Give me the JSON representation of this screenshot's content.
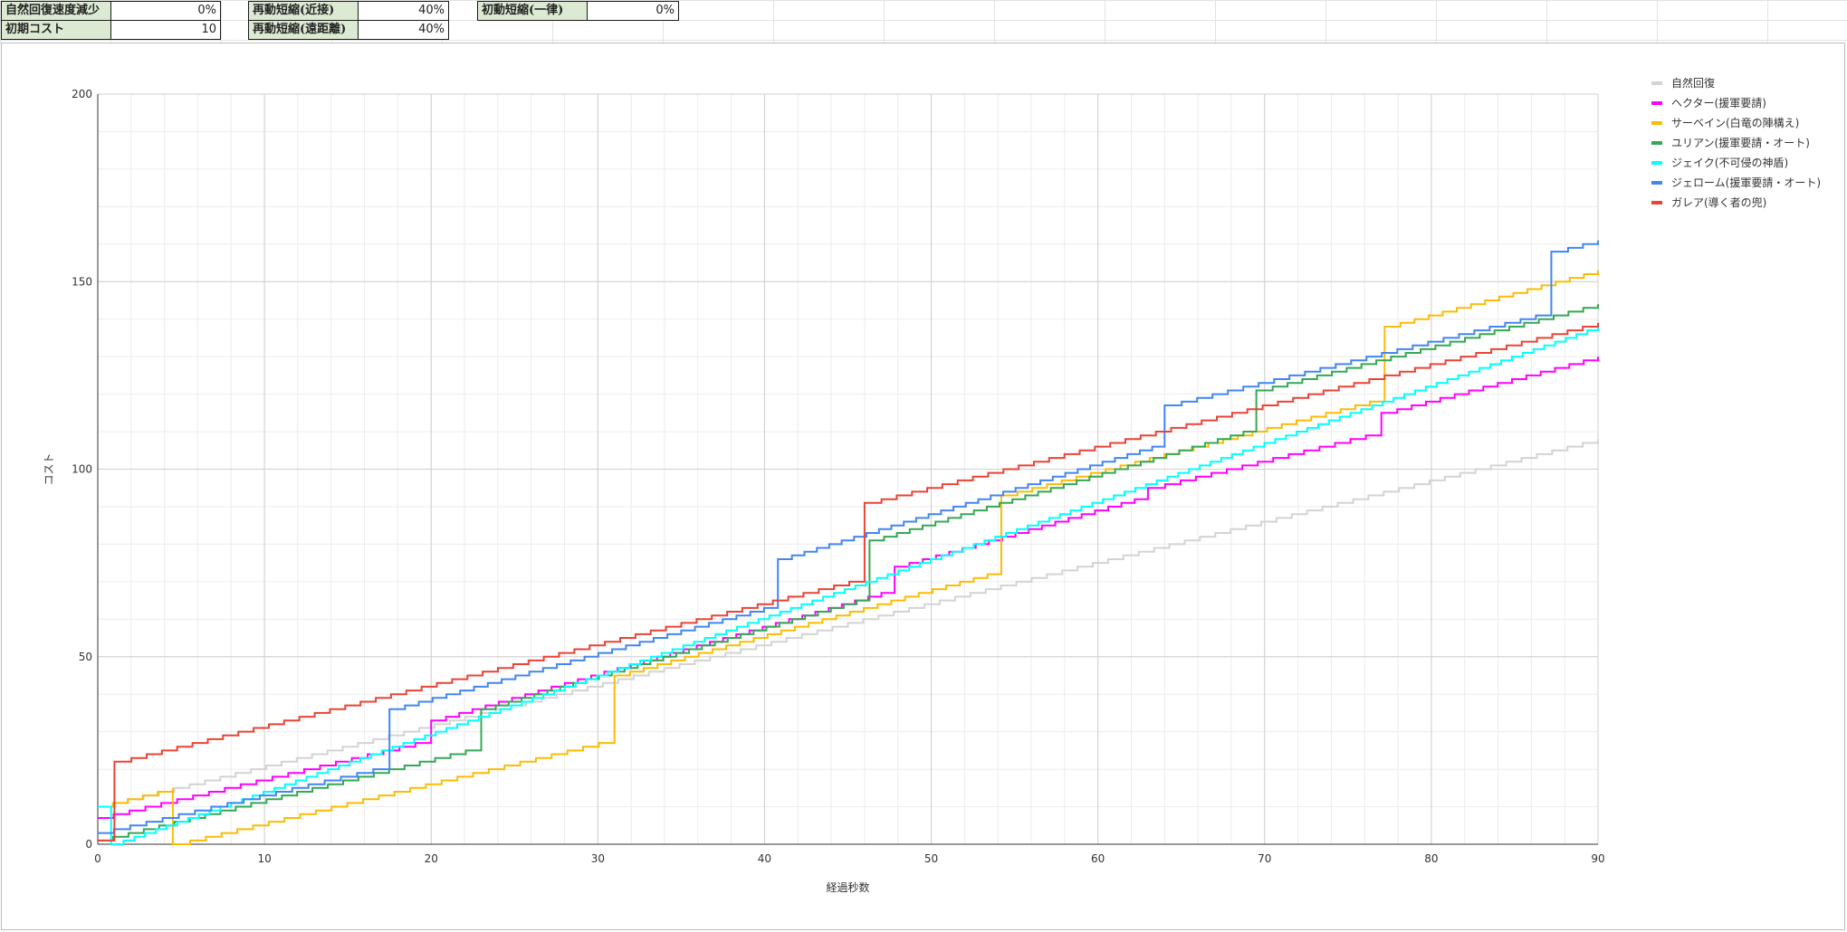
{
  "settings": {
    "regen_reduction_label": "自然回復速度減少",
    "regen_reduction_value": "0%",
    "initial_cost_label": "初期コスト",
    "initial_cost_value": "10",
    "redeploy_melee_label": "再動短縮(近接)",
    "redeploy_melee_value": "40%",
    "redeploy_ranged_label": "再動短縮(遠距離)",
    "redeploy_ranged_value": "40%",
    "initial_redeploy_label": "初動短縮(一律)",
    "initial_redeploy_value": "0%"
  },
  "chart_data": {
    "type": "line",
    "step": true,
    "title": "",
    "xlabel": "経過秒数",
    "ylabel": "コスト",
    "xlim": [
      0,
      90
    ],
    "ylim": [
      0,
      200
    ],
    "xticks": [
      0,
      10,
      20,
      30,
      40,
      50,
      60,
      70,
      80,
      90
    ],
    "yticks": [
      0,
      50,
      100,
      150,
      200
    ],
    "grid": true,
    "legend_position": "top-right",
    "series": [
      {
        "name": "自然回復",
        "color": "#d3d3d3",
        "points": [
          [
            0,
            10
          ],
          [
            90,
            108
          ]
        ]
      },
      {
        "name": "ヘクター(援軍要請)",
        "color": "#ff00ff",
        "points": [
          [
            0,
            7
          ],
          [
            20,
            28
          ],
          [
            20.1,
            33
          ],
          [
            47.8,
            68
          ],
          [
            47.9,
            74
          ],
          [
            63,
            93
          ],
          [
            63.1,
            95
          ],
          [
            77,
            110
          ],
          [
            77.1,
            115
          ],
          [
            90,
            130
          ]
        ]
      },
      {
        "name": "サーベイン(白竜の陣構え)",
        "color": "#fbbc04",
        "points": [
          [
            0,
            10
          ],
          [
            4.5,
            15
          ],
          [
            4.6,
            0
          ],
          [
            31,
            28
          ],
          [
            31.1,
            45
          ],
          [
            54.2,
            73
          ],
          [
            54.3,
            93
          ],
          [
            77.2,
            119
          ],
          [
            77.3,
            138
          ],
          [
            90,
            153
          ]
        ]
      },
      {
        "name": "ユリアン(援軍要請・オート)",
        "color": "#34a853",
        "points": [
          [
            0,
            1
          ],
          [
            23,
            26
          ],
          [
            23.1,
            36
          ],
          [
            46.3,
            66
          ],
          [
            46.4,
            81
          ],
          [
            69.5,
            111
          ],
          [
            69.6,
            121
          ],
          [
            90,
            144
          ]
        ]
      },
      {
        "name": "ジェイク(不可侵の神盾)",
        "color": "#00ffff",
        "points": [
          [
            0,
            10
          ],
          [
            0.8,
            10
          ],
          [
            0.9,
            0
          ],
          [
            90,
            138
          ]
        ]
      },
      {
        "name": "ジェローム(援軍要請・オート)",
        "color": "#4285f4",
        "points": [
          [
            0,
            3
          ],
          [
            17.5,
            21
          ],
          [
            17.6,
            36
          ],
          [
            40.8,
            64
          ],
          [
            40.9,
            76
          ],
          [
            64,
            107
          ],
          [
            64.1,
            117
          ],
          [
            87.2,
            142
          ],
          [
            87.3,
            158
          ],
          [
            90,
            161
          ]
        ]
      },
      {
        "name": "ガレア(導く者の兜)",
        "color": "#ea4335",
        "points": [
          [
            0,
            1
          ],
          [
            1,
            1
          ],
          [
            1.1,
            22
          ],
          [
            46,
            71
          ],
          [
            46.1,
            91
          ],
          [
            90,
            139
          ]
        ]
      }
    ]
  }
}
